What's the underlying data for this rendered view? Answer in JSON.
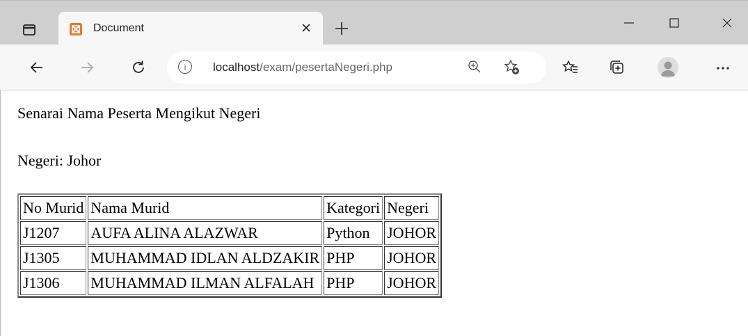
{
  "browser": {
    "tab_title": "Document",
    "url_host": "localhost",
    "url_path": "/exam/pesertaNegeri.php"
  },
  "page": {
    "heading": "Senarai Nama Peserta Mengikut Negeri",
    "negeri_label": "Negeri: ",
    "negeri_value": "Johor"
  },
  "table": {
    "headers": [
      "No Murid",
      "Nama Murid",
      "Kategori",
      "Negeri"
    ],
    "rows": [
      [
        "J1207",
        "AUFA ALINA ALAZWAR",
        "Python",
        "JOHOR"
      ],
      [
        "J1305",
        "MUHAMMAD IDLAN ALDZAKIR",
        "PHP",
        "JOHOR"
      ],
      [
        "J1306",
        "MUHAMMAD ILMAN ALFALAH",
        "PHP",
        "JOHOR"
      ]
    ]
  },
  "icons": {
    "favicon_color": "#e8772e"
  }
}
